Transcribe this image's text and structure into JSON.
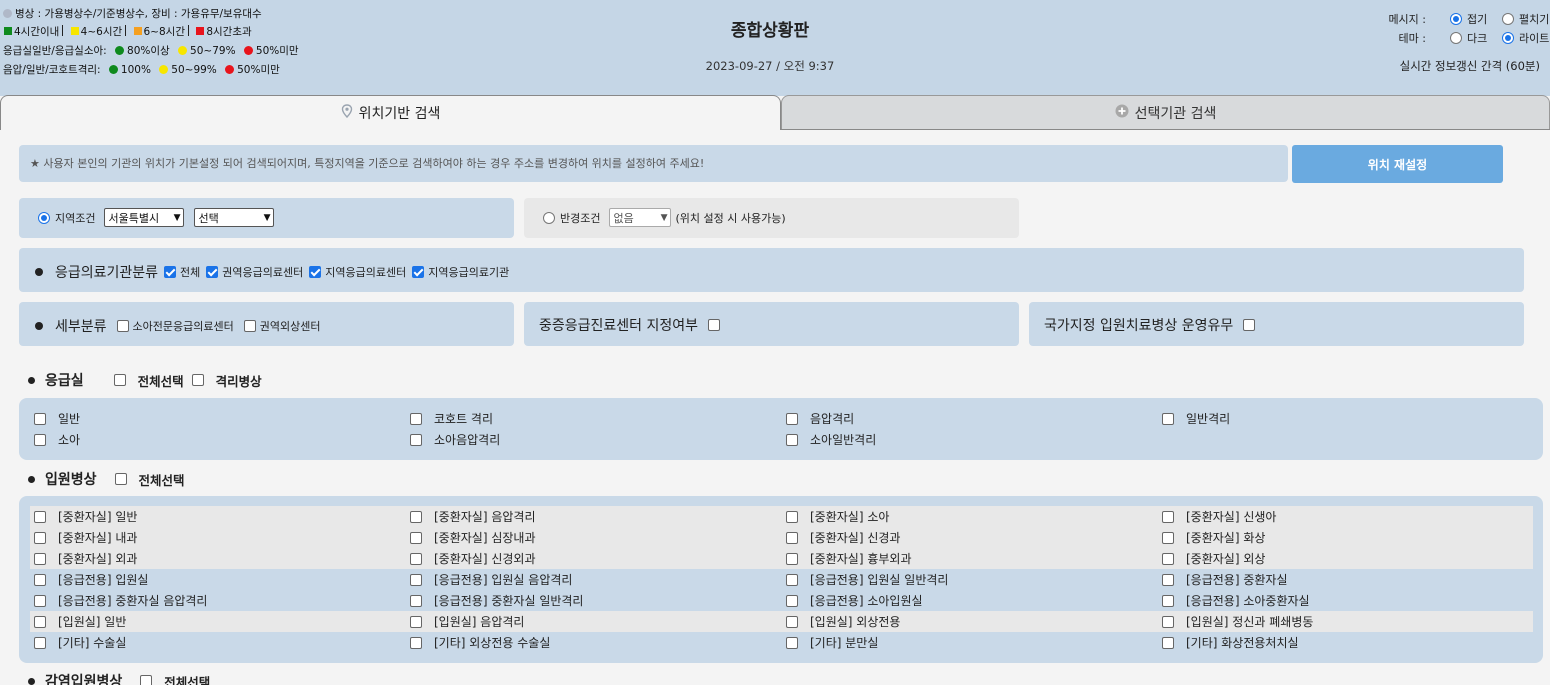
{
  "legend": {
    "line1": "병상 : 가용병상수/기준병상수, 장비 : 가용유무/보유대수",
    "durations": [
      {
        "label": "4시간이내",
        "color": "#0f8a1e"
      },
      {
        "label": "4~6시간",
        "color": "#f7e600"
      },
      {
        "label": "6~8시간",
        "color": "#f5a020"
      },
      {
        "label": "8시간초과",
        "color": "#e8141c"
      }
    ],
    "er_label": "응급실일반/응급실소아:",
    "er_levels": [
      {
        "label": "80%이상",
        "color": "#0f8a1e"
      },
      {
        "label": "50~79%",
        "color": "#f7e600"
      },
      {
        "label": "50%미만",
        "color": "#e8141c"
      }
    ],
    "iso_label": "음압/일반/코호트격리:",
    "iso_levels": [
      {
        "label": "100%",
        "color": "#0f8a1e"
      },
      {
        "label": "50~99%",
        "color": "#f7e600"
      },
      {
        "label": "50%미만",
        "color": "#e8141c"
      }
    ]
  },
  "header": {
    "title": "종합상황판",
    "datetime": "2023-09-27 / 오전 9:37",
    "message_label": "메시지 :",
    "message_opt1": "접기",
    "message_opt2": "펼치기",
    "theme_label": "테마 :",
    "theme_opt1": "다크",
    "theme_opt2": "라이트",
    "refresh": "실시간 정보갱신 간격 (60분)"
  },
  "tabs": {
    "location": "위치기반 검색",
    "selected": "선택기관 검색"
  },
  "notice": {
    "text": "★ 사용자 본인의 기관의 위치가 기본설정 되어 검색되어지며, 특정지역을 기준으로 검색하여야 하는 경우 주소를 변경하여 위치를 설정하여 주세요!",
    "reset_button": "위치 재설정"
  },
  "region": {
    "label": "지역조건",
    "city": "서울특별시",
    "district": "선택"
  },
  "radius": {
    "label": "반경조건",
    "value": "없음",
    "note": "(위치 설정 시 사용가능)"
  },
  "classification": {
    "label": "응급의료기관분류",
    "options": [
      "전체",
      "권역응급의료센터",
      "지역응급의료센터",
      "지역응급의료기관"
    ]
  },
  "subclass": {
    "label": "세부분류",
    "options": [
      "소아전문응급의료센터",
      "권역외상센터"
    ]
  },
  "severe_center": "중증응급진료센터 지정여부",
  "national_beds": "국가지정 입원치료병상 운영유무",
  "er_section": {
    "title": "응급실",
    "select_all": "전체선택",
    "isolation": "격리병상",
    "items": [
      "일반",
      "코호트 격리",
      "음압격리",
      "일반격리",
      "소아",
      "소아음압격리",
      "소아일반격리"
    ]
  },
  "inpatient_section": {
    "title": "입원병상",
    "select_all": "전체선택",
    "items": [
      "[중환자실] 일반",
      "[중환자실] 음압격리",
      "[중환자실] 소아",
      "[중환자실] 신생아",
      "[중환자실] 내과",
      "[중환자실] 심장내과",
      "[중환자실] 신경과",
      "[중환자실] 화상",
      "[중환자실] 외과",
      "[중환자실] 신경외과",
      "[중환자실] 흉부외과",
      "[중환자실] 외상",
      "[응급전용] 입원실",
      "[응급전용] 입원실 음압격리",
      "[응급전용] 입원실 일반격리",
      "[응급전용] 중환자실",
      "[응급전용] 중환자실 음압격리",
      "[응급전용] 중환자실 일반격리",
      "[응급전용] 소아입원실",
      "[응급전용] 소아중환자실",
      "[입원실] 일반",
      "[입원실] 음압격리",
      "[입원실] 외상전용",
      "[입원실] 정신과 폐쇄병동",
      "[기타] 수술실",
      "[기타] 외상전용 수술실",
      "[기타] 분만실",
      "[기타] 화상전용처치실"
    ]
  },
  "infection_section": {
    "title": "감염입원병상",
    "select_all": "전체선택"
  }
}
